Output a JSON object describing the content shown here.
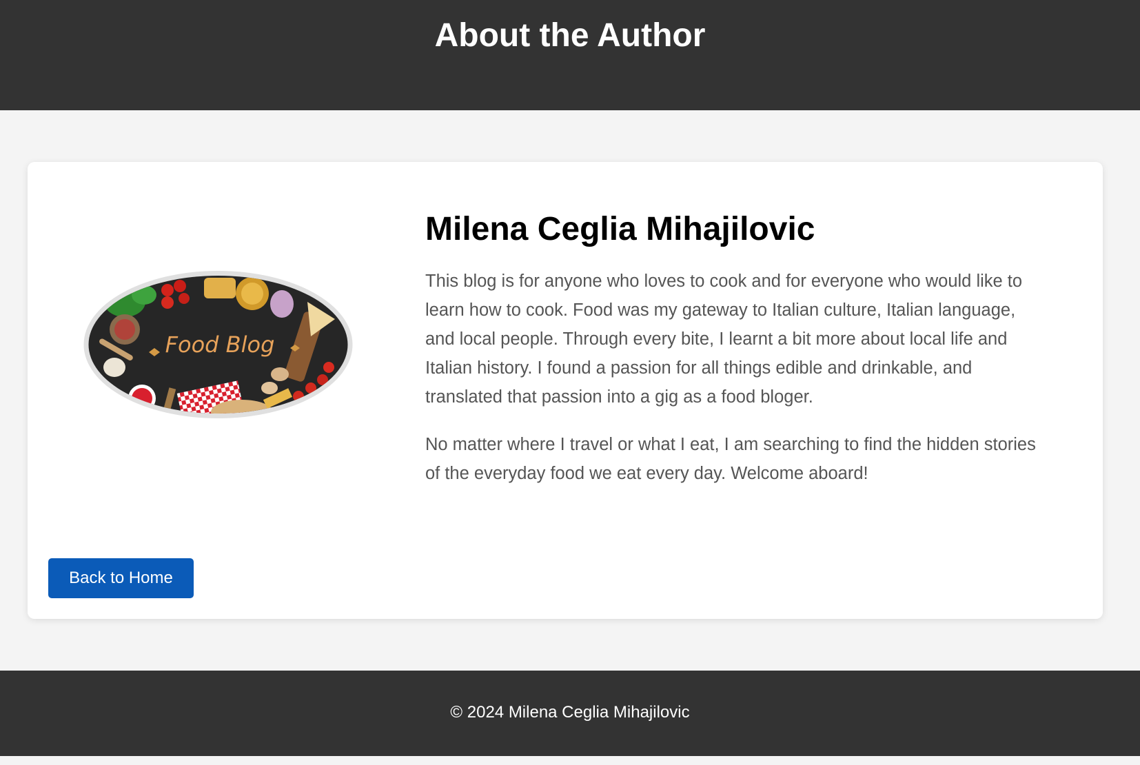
{
  "header": {
    "title": "About the Author"
  },
  "author": {
    "name": "Milena Ceglia Mihajilovic",
    "logo_text": "Food Blog",
    "bio": [
      "This blog is for anyone who loves to cook and for everyone who would like to learn how to cook. Food was my gateway to Italian culture, Italian language, and local people. Through every bite, I learnt a bit more about local life and Italian history. I found a passion for all things edible and drinkable, and translated that passion into a gig as a food bloger.",
      "No matter where I travel or what I eat, I am searching to find the hidden stories of the everyday food we eat every day. Welcome aboard!"
    ]
  },
  "actions": {
    "back_home_label": "Back to Home"
  },
  "footer": {
    "copyright": "© 2024 Milena Ceglia Mihajilovic"
  },
  "colors": {
    "header_bg": "#333333",
    "page_bg": "#f4f4f4",
    "button_bg": "#0b5bb8",
    "body_text": "#555555"
  }
}
